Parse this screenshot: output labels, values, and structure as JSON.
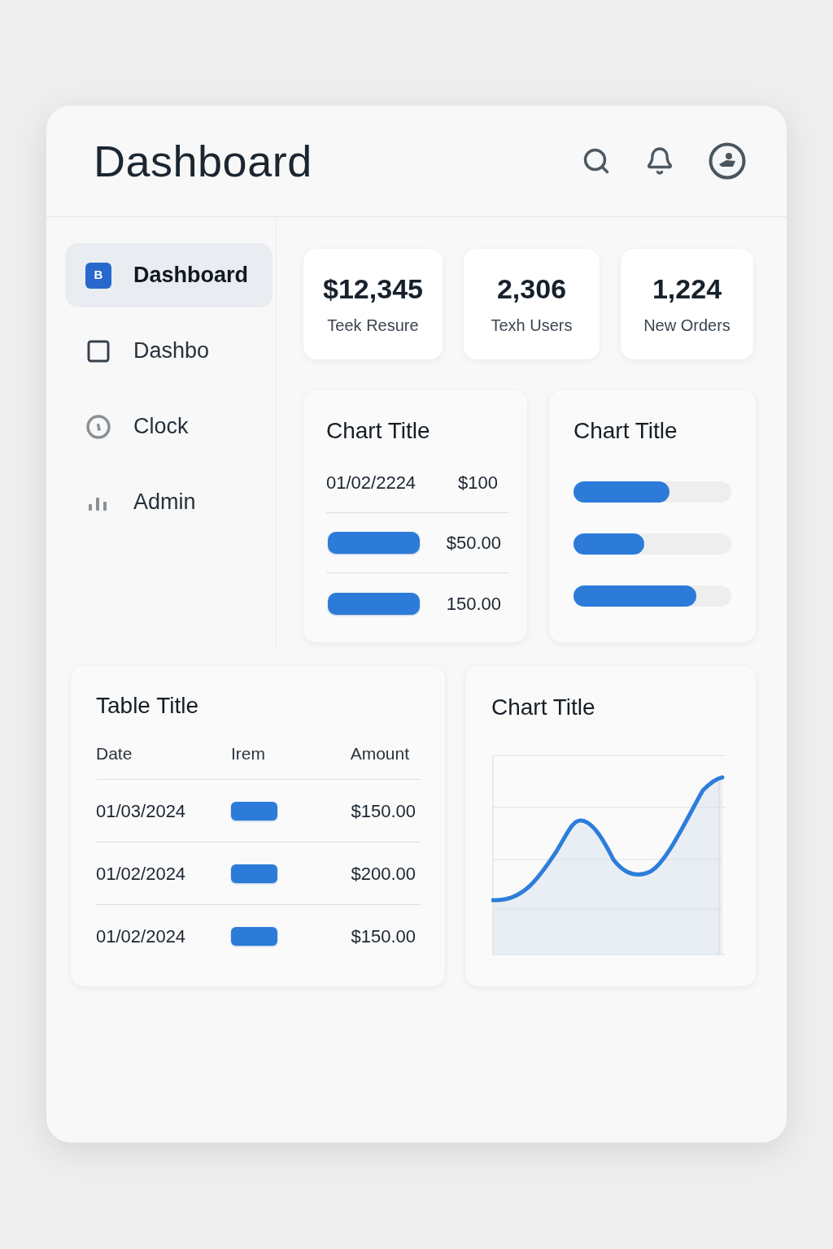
{
  "header": {
    "title": "Dashboard"
  },
  "sidebar": {
    "items": [
      {
        "kind": "badge",
        "badge": "B",
        "label": "Dashboard",
        "selected": true
      },
      {
        "kind": "square",
        "label": "Dashbo",
        "selected": false
      },
      {
        "kind": "clock",
        "label": "Clock",
        "selected": false
      },
      {
        "kind": "bars",
        "label": "Admin",
        "selected": false
      }
    ]
  },
  "stats": [
    {
      "value": "$12,345",
      "label": "Teek Resure"
    },
    {
      "value": "2,306",
      "label": "Texh Users"
    },
    {
      "value": "1,224",
      "label": "New Orders"
    }
  ],
  "list_card": {
    "title": "Chart Title",
    "top_row": {
      "date": "01/02/2224",
      "amount": "$100"
    },
    "rows": [
      {
        "amount": "$50.00"
      },
      {
        "amount": "150.00"
      }
    ]
  },
  "bars_card": {
    "title": "Chart Title",
    "bars": [
      {
        "level": 0.61
      },
      {
        "level": 0.45
      },
      {
        "level": 0.78
      }
    ]
  },
  "table": {
    "title": "Table Title",
    "columns": [
      "Date",
      "Irem",
      "Amount"
    ],
    "rows": [
      {
        "date": "01/03/2024",
        "amount": "$150.00"
      },
      {
        "date": "01/02/2024",
        "amount": "$200.00"
      },
      {
        "date": "01/02/2024",
        "amount": "$150.00"
      }
    ]
  },
  "line_card": {
    "title": "Chart Title"
  }
}
